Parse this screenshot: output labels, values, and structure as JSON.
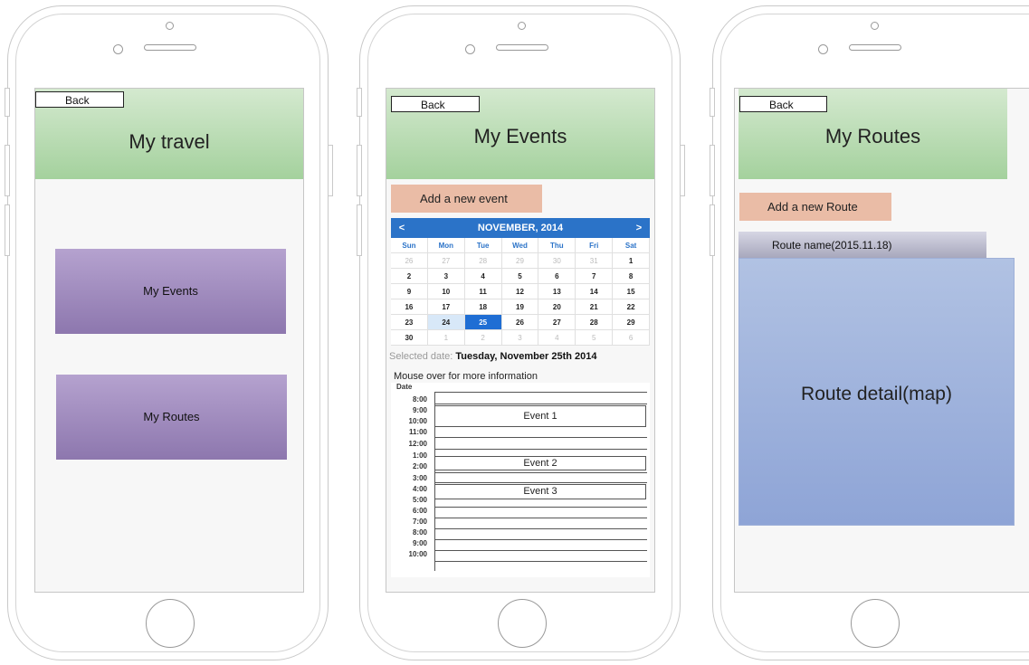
{
  "screens": {
    "travel": {
      "back_label": "Back",
      "title": "My travel",
      "events_button": "My Events",
      "routes_button": "My Routes"
    },
    "events": {
      "back_label": "Back",
      "title": "My Events",
      "add_button": "Add a new event",
      "calendar": {
        "prev": "<",
        "next": ">",
        "month_label": "NOVEMBER, 2014",
        "weekdays": [
          "Sun",
          "Mon",
          "Tue",
          "Wed",
          "Thu",
          "Fri",
          "Sat"
        ],
        "weeks": [
          [
            "26",
            "27",
            "28",
            "29",
            "30",
            "31",
            "1"
          ],
          [
            "2",
            "3",
            "4",
            "5",
            "6",
            "7",
            "8"
          ],
          [
            "9",
            "10",
            "11",
            "12",
            "13",
            "14",
            "15"
          ],
          [
            "16",
            "17",
            "18",
            "19",
            "20",
            "21",
            "22"
          ],
          [
            "23",
            "24",
            "25",
            "26",
            "27",
            "28",
            "29"
          ],
          [
            "30",
            "1",
            "2",
            "3",
            "4",
            "5",
            "6"
          ]
        ]
      },
      "selected_prefix": "Selected date: ",
      "selected_value": "Tuesday, November 25th 2014",
      "hint": "Mouse over for more information",
      "schedule": {
        "date_header": "Date",
        "times": [
          "8:00",
          "9:00",
          "10:00",
          "11:00",
          "12:00",
          "1:00",
          "2:00",
          "3:00",
          "4:00",
          "5:00",
          "6:00",
          "7:00",
          "8:00",
          "9:00",
          "10:00"
        ],
        "events": [
          "Event 1",
          "Event 2",
          "Event 3"
        ]
      }
    },
    "routes": {
      "back_label": "Back",
      "title": "My Routes",
      "add_button": "Add a new Route",
      "route_name": "Route name(2015.11.18)",
      "map_label": "Route detail(map)"
    }
  }
}
